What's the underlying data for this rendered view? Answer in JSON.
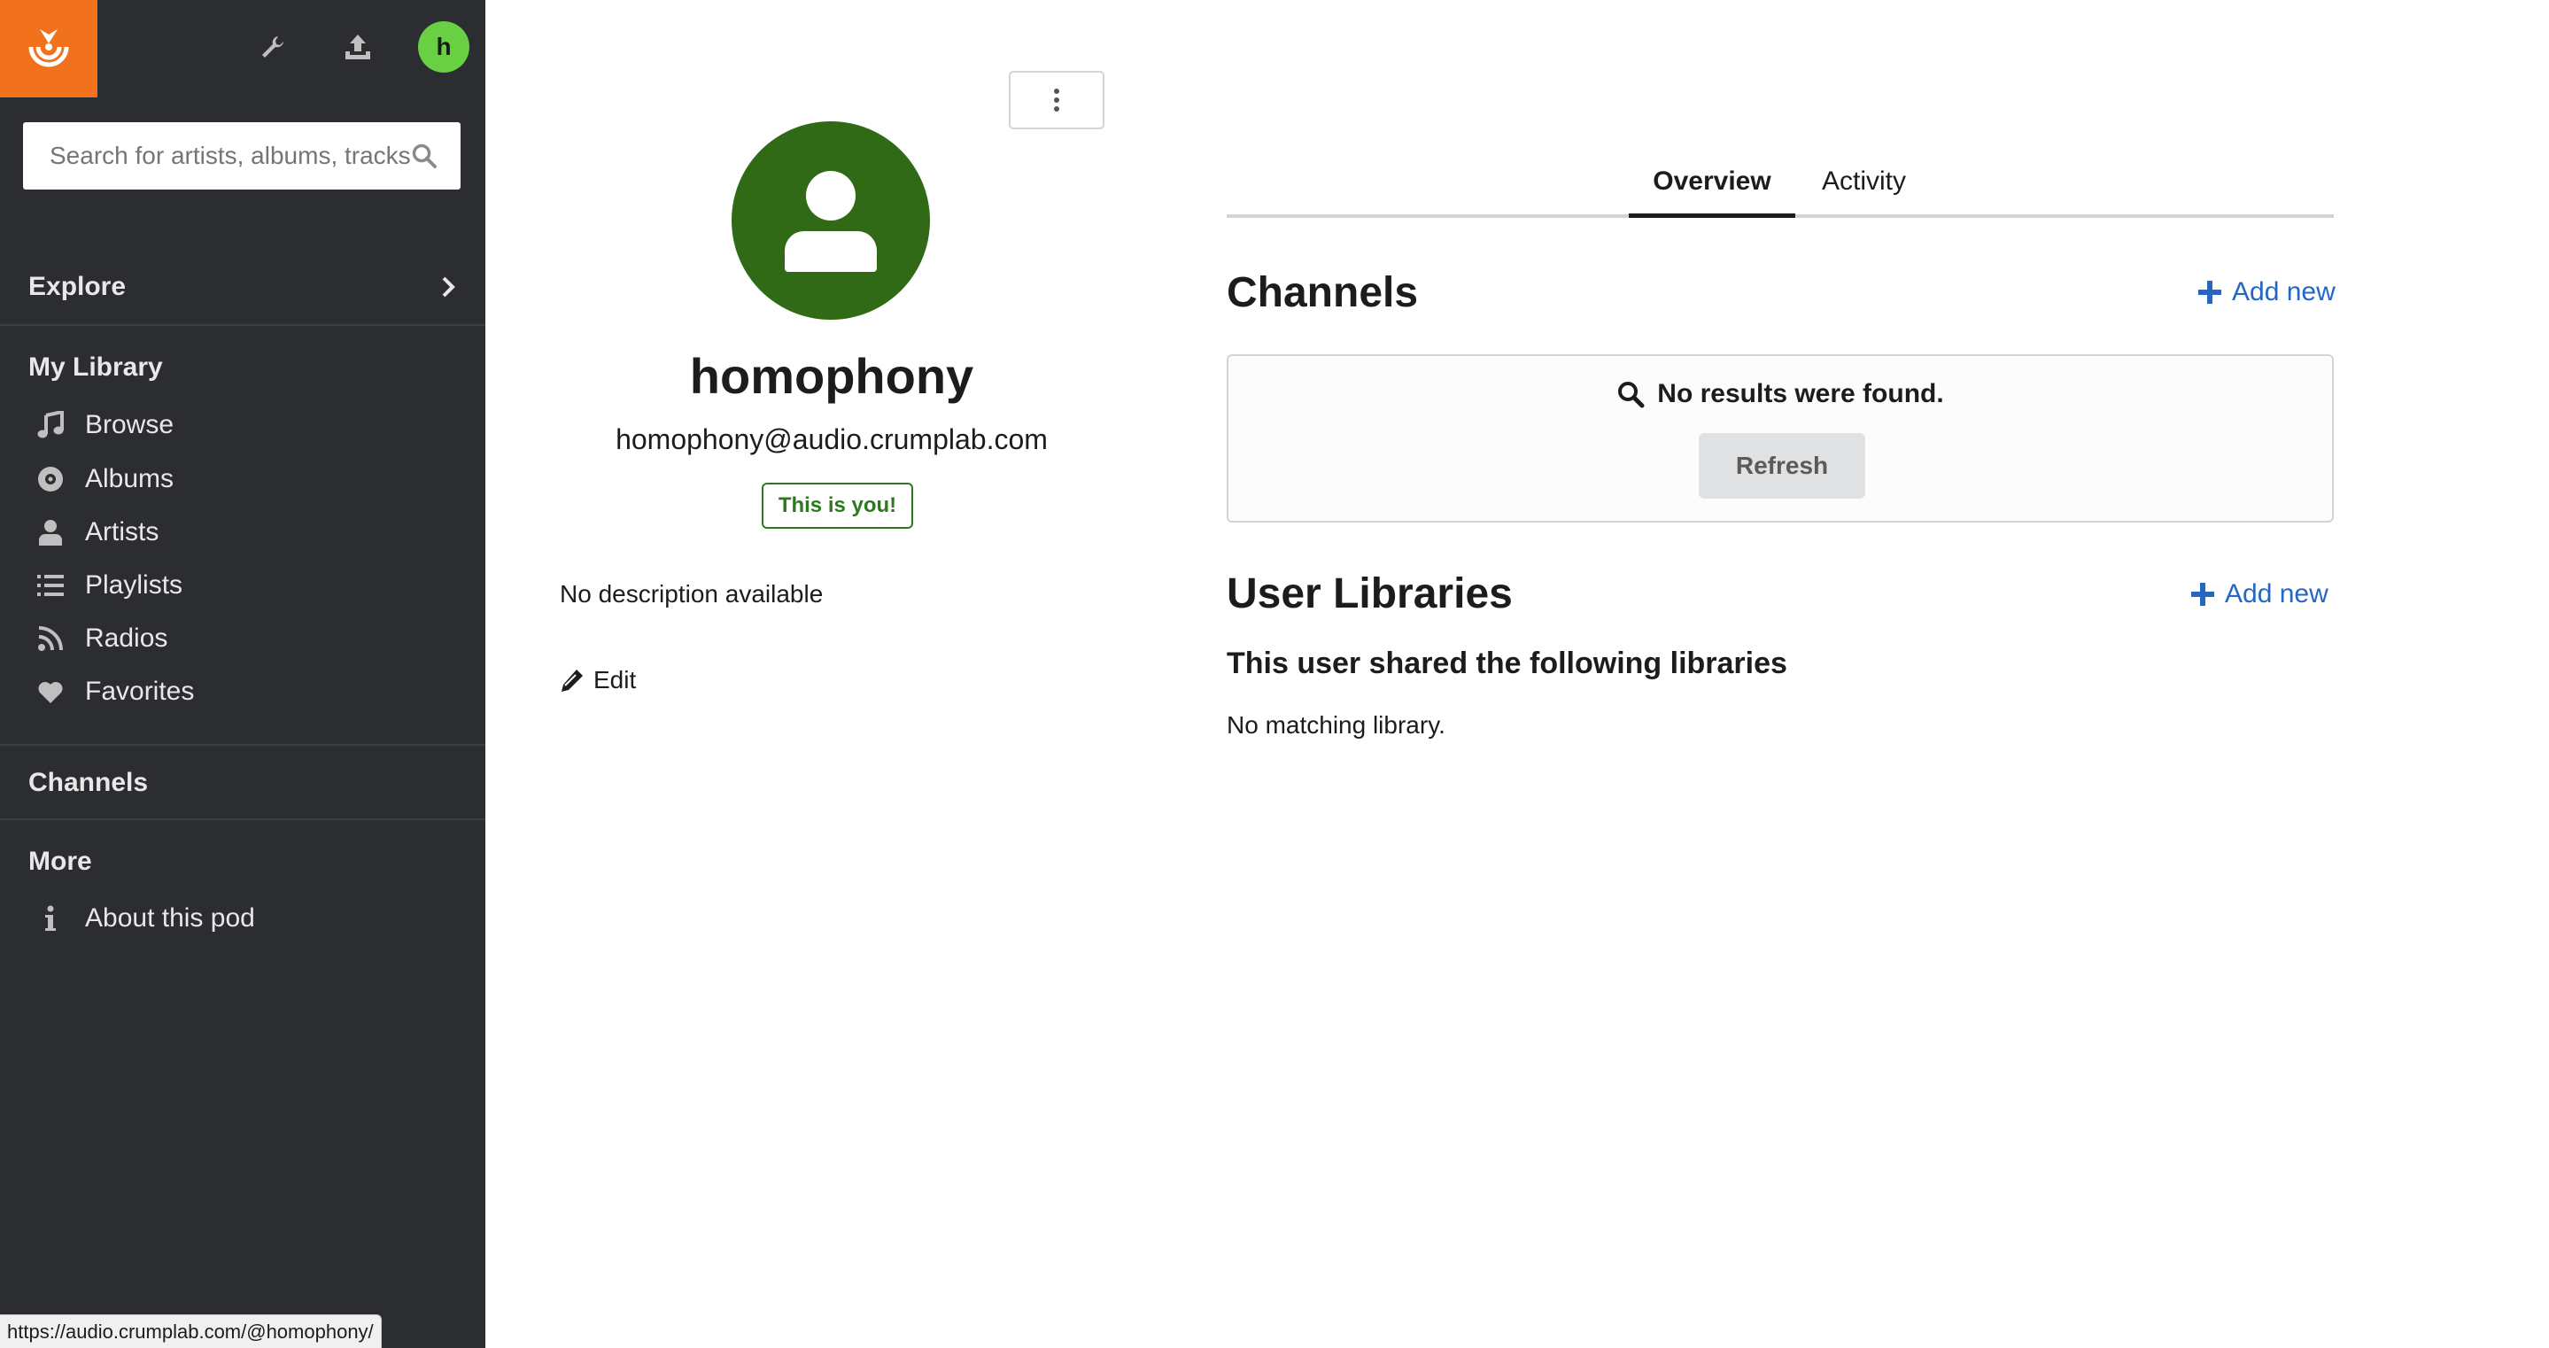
{
  "sidebar": {
    "search_placeholder": "Search for artists, albums, tracks…",
    "user_initial": "h",
    "explore_label": "Explore",
    "library_title": "My Library",
    "library_items": [
      {
        "label": "Browse",
        "icon": "music-note-icon"
      },
      {
        "label": "Albums",
        "icon": "disc-icon"
      },
      {
        "label": "Artists",
        "icon": "user-icon"
      },
      {
        "label": "Playlists",
        "icon": "list-icon"
      },
      {
        "label": "Radios",
        "icon": "rss-icon"
      },
      {
        "label": "Favorites",
        "icon": "heart-icon"
      }
    ],
    "channels_label": "Channels",
    "more_title": "More",
    "about_label": "About this pod"
  },
  "profile": {
    "username": "homophony",
    "email": "homophony@audio.crumplab.com",
    "badge": "This is you!",
    "description": "No description available",
    "edit_label": "Edit"
  },
  "tabs": {
    "overview": "Overview",
    "activity": "Activity",
    "active": "Overview"
  },
  "channels": {
    "title": "Channels",
    "add_new": "Add new",
    "empty_message": "No results were found.",
    "refresh_label": "Refresh"
  },
  "libraries": {
    "title": "User Libraries",
    "add_new": "Add new",
    "subtitle": "This user shared the following libraries",
    "empty_message": "No matching library."
  },
  "status_bar_url": "https://audio.crumplab.com/@homophony/",
  "colors": {
    "sidebar_bg": "#2b2d31",
    "logo_bg": "#f2711c",
    "avatar_bg": "#68d042",
    "profile_avatar_bg": "#316a16",
    "badge_green": "#2c7a1e",
    "link_blue": "#2466c4"
  }
}
